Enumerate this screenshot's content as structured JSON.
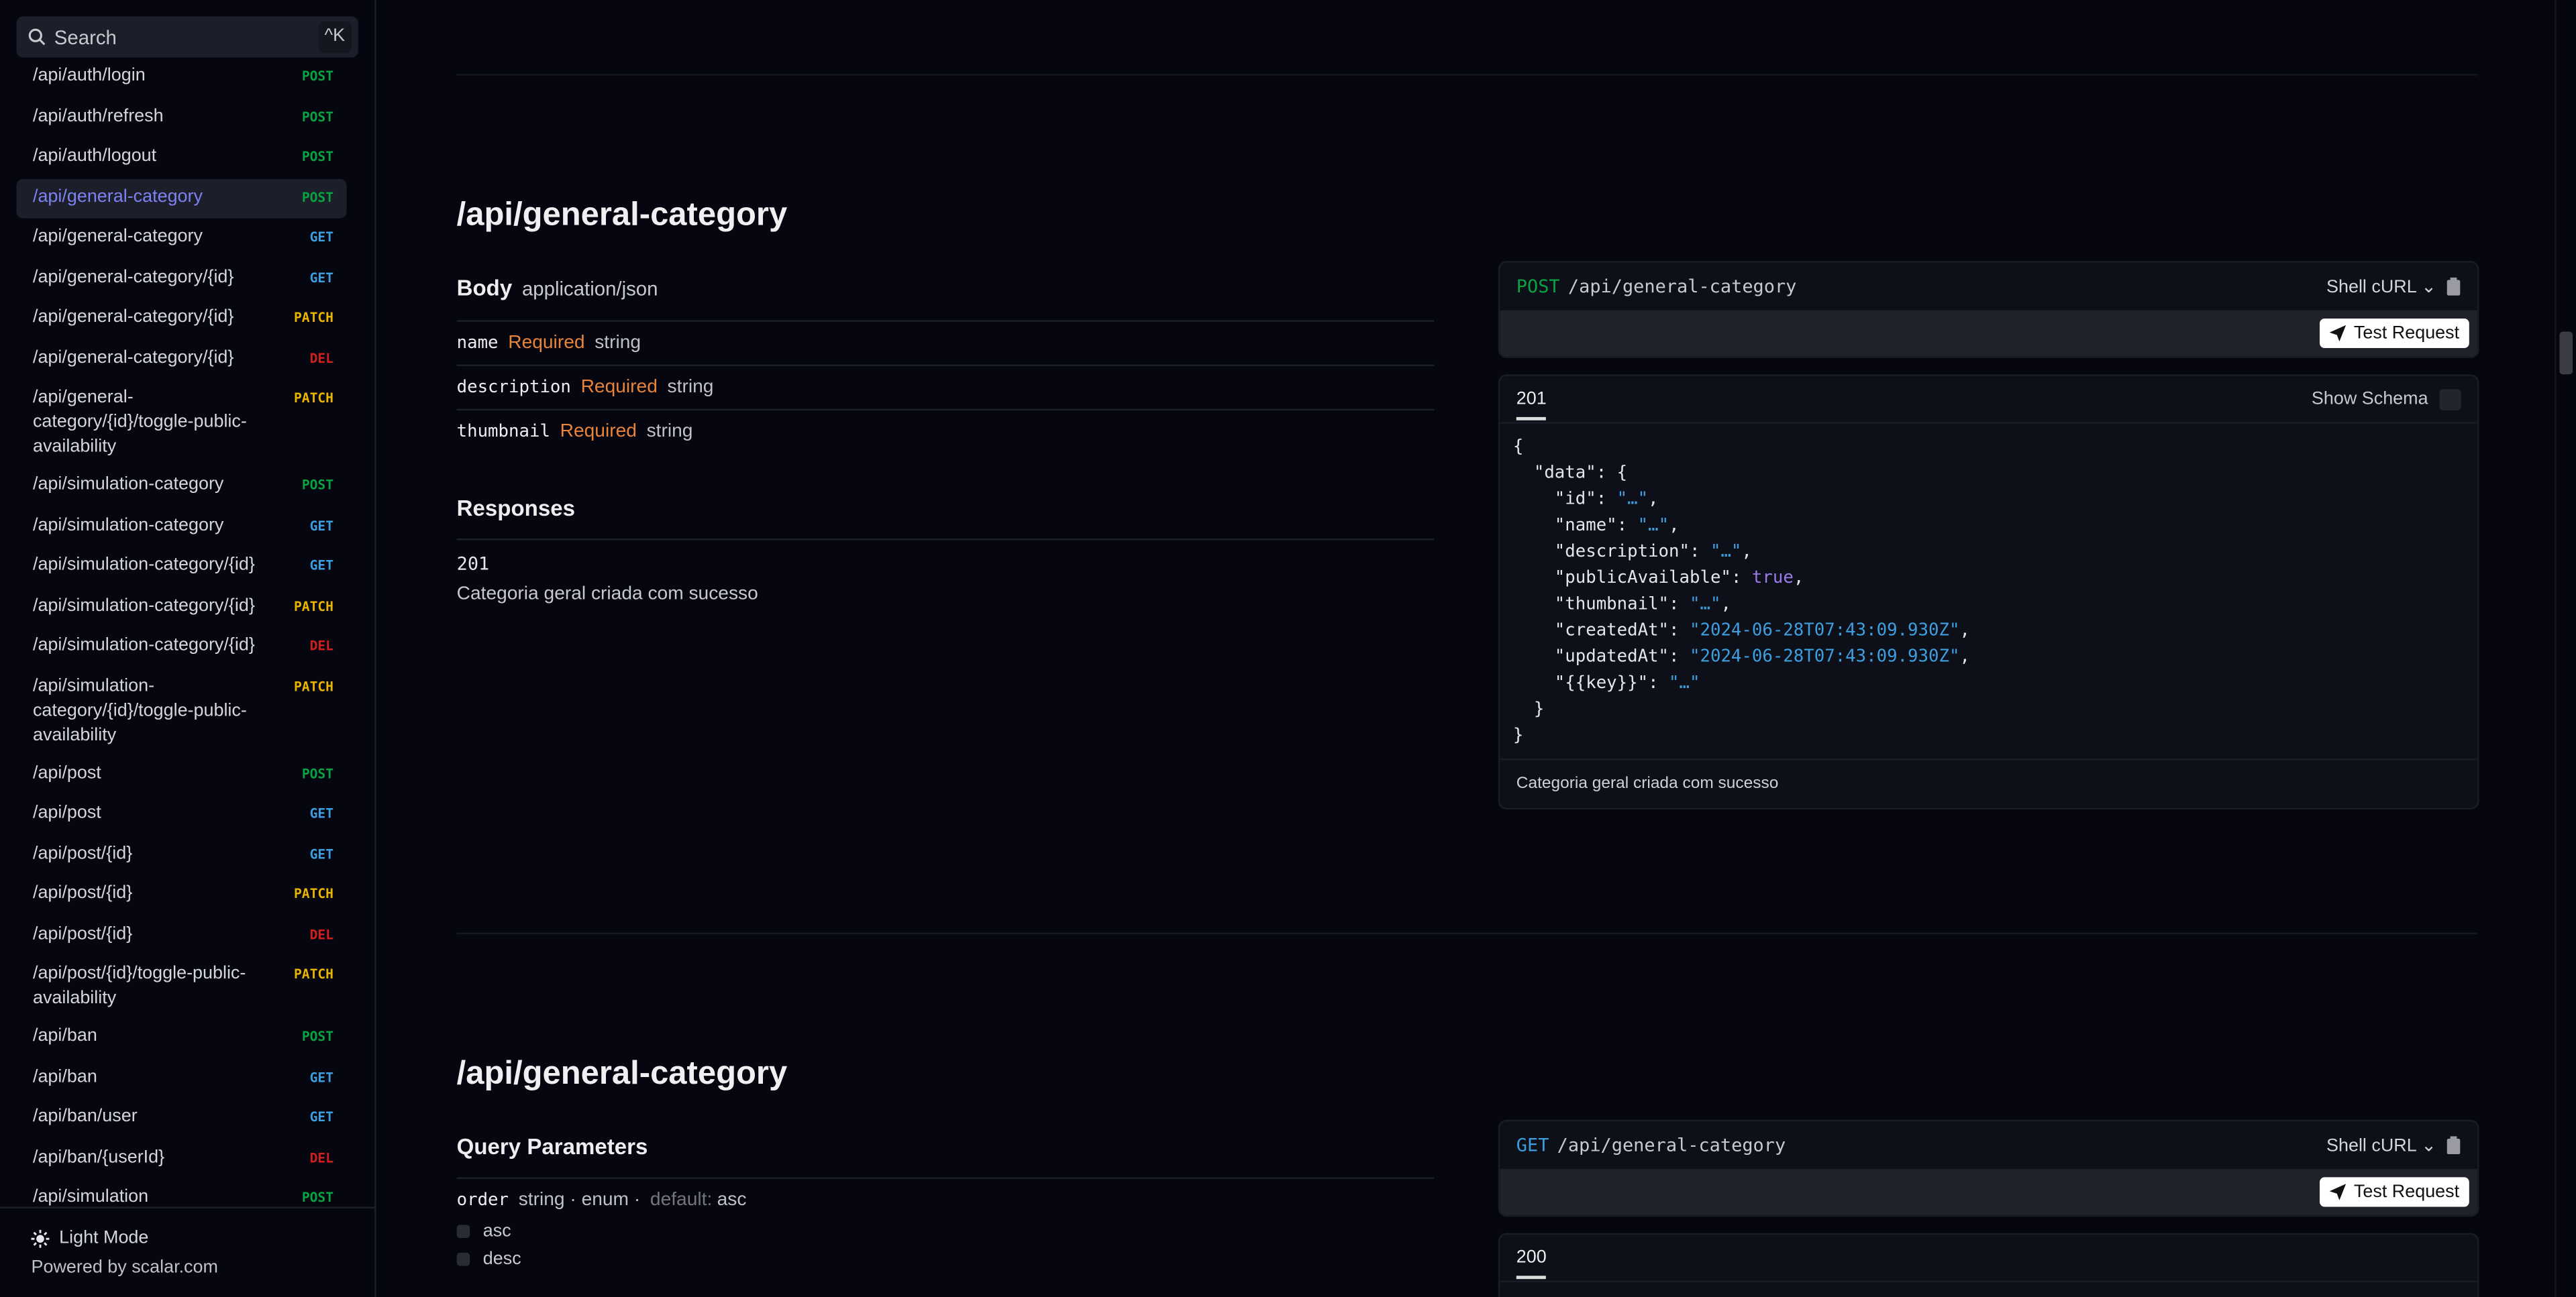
{
  "sidebar": {
    "search": {
      "placeholder": "Search",
      "shortcut": "^K"
    },
    "items": [
      {
        "path": "/api/auth/login",
        "method": "POST"
      },
      {
        "path": "/api/auth/refresh",
        "method": "POST"
      },
      {
        "path": "/api/auth/logout",
        "method": "POST"
      },
      {
        "path": "/api/general-category",
        "method": "POST",
        "active": true
      },
      {
        "path": "/api/general-category",
        "method": "GET"
      },
      {
        "path": "/api/general-category/{id}",
        "method": "GET"
      },
      {
        "path": "/api/general-category/{id}",
        "method": "PATCH"
      },
      {
        "path": "/api/general-category/{id}",
        "method": "DEL"
      },
      {
        "path": "/api/general-category/{id}/toggle-public-availability",
        "method": "PATCH"
      },
      {
        "path": "/api/simulation-category",
        "method": "POST"
      },
      {
        "path": "/api/simulation-category",
        "method": "GET"
      },
      {
        "path": "/api/simulation-category/{id}",
        "method": "GET"
      },
      {
        "path": "/api/simulation-category/{id}",
        "method": "PATCH"
      },
      {
        "path": "/api/simulation-category/{id}",
        "method": "DEL"
      },
      {
        "path": "/api/simulation-category/{id}/toggle-public-availability",
        "method": "PATCH"
      },
      {
        "path": "/api/post",
        "method": "POST"
      },
      {
        "path": "/api/post",
        "method": "GET"
      },
      {
        "path": "/api/post/{id}",
        "method": "GET"
      },
      {
        "path": "/api/post/{id}",
        "method": "PATCH"
      },
      {
        "path": "/api/post/{id}",
        "method": "DEL"
      },
      {
        "path": "/api/post/{id}/toggle-public-availability",
        "method": "PATCH"
      },
      {
        "path": "/api/ban",
        "method": "POST"
      },
      {
        "path": "/api/ban",
        "method": "GET"
      },
      {
        "path": "/api/ban/user",
        "method": "GET"
      },
      {
        "path": "/api/ban/{userId}",
        "method": "DEL"
      },
      {
        "path": "/api/simulation",
        "method": "POST"
      }
    ],
    "footer": {
      "light_mode": "Light Mode",
      "powered": "Powered by scalar.com"
    }
  },
  "colors": {
    "POST": "#09a441",
    "GET": "#3b9ee0",
    "PATCH": "#e8b400",
    "DEL": "#d21e1e",
    "required": "#e8833a",
    "active": "#7b83f0"
  },
  "sections": [
    {
      "title": "/api/general-category",
      "body": {
        "label": "Body",
        "type": "application/json",
        "fields": [
          {
            "name": "name",
            "required": "Required",
            "type": "string"
          },
          {
            "name": "description",
            "required": "Required",
            "type": "string"
          },
          {
            "name": "thumbnail",
            "required": "Required",
            "type": "string"
          }
        ]
      },
      "responses": {
        "label": "Responses",
        "code": "201",
        "description": "Categoria geral criada com sucesso"
      },
      "request": {
        "method": "POST",
        "path": "/api/general-category",
        "client": "Shell cURL",
        "test": "Test Request"
      },
      "response_panel": {
        "code": "201",
        "show_schema": "Show Schema",
        "footer": "Categoria geral criada com sucesso",
        "json": {
          "id": "…",
          "name": "…",
          "description": "…",
          "publicAvailable": "true",
          "thumbnail": "…",
          "createdAt": "2024-06-28T07:43:09.930Z",
          "updatedAt": "2024-06-28T07:43:09.930Z",
          "key": "…"
        }
      }
    },
    {
      "title": "/api/general-category",
      "query": {
        "label": "Query Parameters",
        "param": {
          "name": "order",
          "type": "string · enum ·",
          "default_label": "default:",
          "default": "asc",
          "options": [
            "asc",
            "desc"
          ]
        }
      },
      "request": {
        "method": "GET",
        "path": "/api/general-category",
        "client": "Shell cURL",
        "test": "Test Request"
      },
      "response_panel": {
        "code": "200"
      }
    }
  ]
}
